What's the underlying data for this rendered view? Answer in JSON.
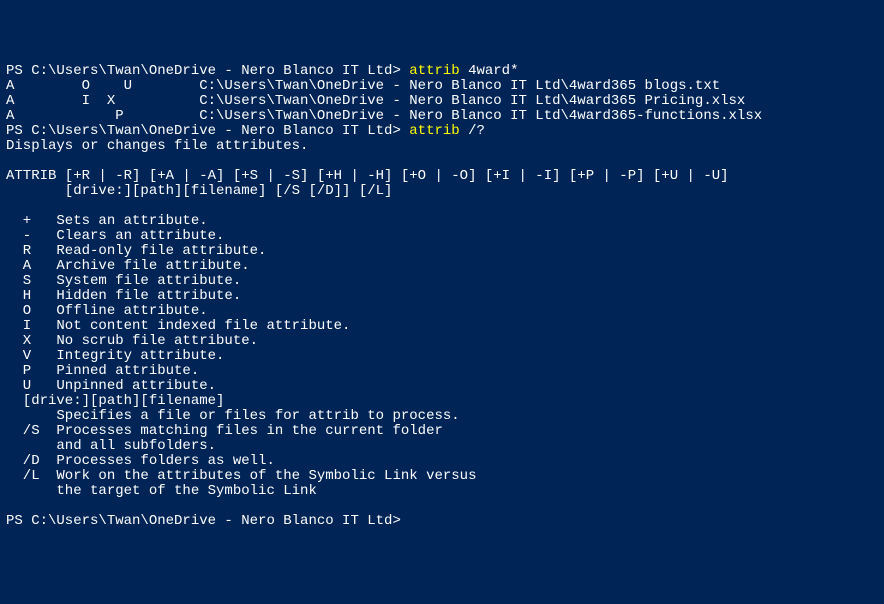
{
  "lines": [
    {
      "segments": [
        {
          "t": "PS C:\\Users\\Twan\\OneDrive - Nero Blanco IT Ltd> ",
          "c": "prompt"
        },
        {
          "t": "attrib ",
          "c": "cmd"
        },
        {
          "t": "4ward*",
          "c": "arg"
        }
      ]
    },
    {
      "segments": [
        {
          "t": "A        O    U        C:\\Users\\Twan\\OneDrive - Nero Blanco IT Ltd\\4ward365 blogs.txt",
          "c": "output"
        }
      ]
    },
    {
      "segments": [
        {
          "t": "A        I  X          C:\\Users\\Twan\\OneDrive - Nero Blanco IT Ltd\\4ward365 Pricing.xlsx",
          "c": "output"
        }
      ]
    },
    {
      "segments": [
        {
          "t": "A            P         C:\\Users\\Twan\\OneDrive - Nero Blanco IT Ltd\\4ward365-functions.xlsx",
          "c": "output"
        }
      ]
    },
    {
      "segments": [
        {
          "t": "PS C:\\Users\\Twan\\OneDrive - Nero Blanco IT Ltd> ",
          "c": "prompt"
        },
        {
          "t": "attrib ",
          "c": "cmd"
        },
        {
          "t": "/?",
          "c": "arg"
        }
      ]
    },
    {
      "segments": [
        {
          "t": "Displays or changes file attributes.",
          "c": "output"
        }
      ]
    },
    {
      "segments": [
        {
          "t": "",
          "c": "output"
        }
      ]
    },
    {
      "segments": [
        {
          "t": "ATTRIB [+R | -R] [+A | -A] [+S | -S] [+H | -H] [+O | -O] [+I | -I] [+P | -P] [+U | -U]",
          "c": "output"
        }
      ]
    },
    {
      "segments": [
        {
          "t": "       [drive:][path][filename] [/S [/D]] [/L]",
          "c": "output"
        }
      ]
    },
    {
      "segments": [
        {
          "t": "",
          "c": "output"
        }
      ]
    },
    {
      "segments": [
        {
          "t": "  +   Sets an attribute.",
          "c": "output"
        }
      ]
    },
    {
      "segments": [
        {
          "t": "  -   Clears an attribute.",
          "c": "output"
        }
      ]
    },
    {
      "segments": [
        {
          "t": "  R   Read-only file attribute.",
          "c": "output"
        }
      ]
    },
    {
      "segments": [
        {
          "t": "  A   Archive file attribute.",
          "c": "output"
        }
      ]
    },
    {
      "segments": [
        {
          "t": "  S   System file attribute.",
          "c": "output"
        }
      ]
    },
    {
      "segments": [
        {
          "t": "  H   Hidden file attribute.",
          "c": "output"
        }
      ]
    },
    {
      "segments": [
        {
          "t": "  O   Offline attribute.",
          "c": "output"
        }
      ]
    },
    {
      "segments": [
        {
          "t": "  I   Not content indexed file attribute.",
          "c": "output"
        }
      ]
    },
    {
      "segments": [
        {
          "t": "  X   No scrub file attribute.",
          "c": "output"
        }
      ]
    },
    {
      "segments": [
        {
          "t": "  V   Integrity attribute.",
          "c": "output"
        }
      ]
    },
    {
      "segments": [
        {
          "t": "  P   Pinned attribute.",
          "c": "output"
        }
      ]
    },
    {
      "segments": [
        {
          "t": "  U   Unpinned attribute.",
          "c": "output"
        }
      ]
    },
    {
      "segments": [
        {
          "t": "  [drive:][path][filename]",
          "c": "output"
        }
      ]
    },
    {
      "segments": [
        {
          "t": "      Specifies a file or files for attrib to process.",
          "c": "output"
        }
      ]
    },
    {
      "segments": [
        {
          "t": "  /S  Processes matching files in the current folder",
          "c": "output"
        }
      ]
    },
    {
      "segments": [
        {
          "t": "      and all subfolders.",
          "c": "output"
        }
      ]
    },
    {
      "segments": [
        {
          "t": "  /D  Processes folders as well.",
          "c": "output"
        }
      ]
    },
    {
      "segments": [
        {
          "t": "  /L  Work on the attributes of the Symbolic Link versus",
          "c": "output"
        }
      ]
    },
    {
      "segments": [
        {
          "t": "      the target of the Symbolic Link",
          "c": "output"
        }
      ]
    },
    {
      "segments": [
        {
          "t": "",
          "c": "output"
        }
      ]
    },
    {
      "segments": [
        {
          "t": "PS C:\\Users\\Twan\\OneDrive - Nero Blanco IT Ltd> ",
          "c": "prompt"
        }
      ]
    }
  ]
}
